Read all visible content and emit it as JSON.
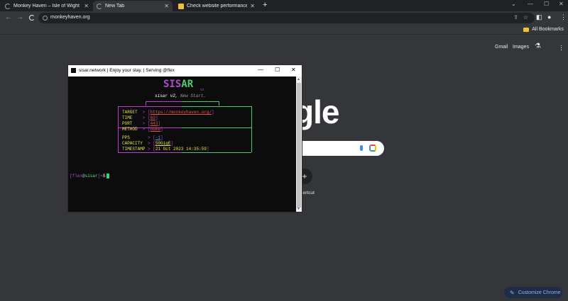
{
  "browser": {
    "tabs": [
      {
        "title": "Monkey Haven – Isle of Wight F",
        "active": false
      },
      {
        "title": "New Tab",
        "active": true
      },
      {
        "title": "Check website performance and",
        "active": false
      }
    ],
    "url": "monkeyhaven.org",
    "bookmarks_label": "All Bookmarks"
  },
  "ntp": {
    "gmail": "Gmail",
    "images": "Images",
    "logo_fragment": "gle",
    "shortcut_plus": "+",
    "shortcut_label": "hortcut",
    "customize_label": "Customize Chrome"
  },
  "terminal": {
    "title": "sisar.network | Enjoy your stay.  | Serving @flex",
    "art_left": "SIS",
    "art_right": "AR",
    "art_version": "V2",
    "subtitle_prefix": "sisar v2,",
    "subtitle_suffix": "New Start.",
    "target_key": "TARGET",
    "target_val": "https://monkeyhaven.org/",
    "time_key": "TIME",
    "time_val": "60",
    "port_key": "PORT",
    "port_val": "443",
    "method_key": "METHOD",
    "method_val": "nuke",
    "pps_key": "PPS",
    "pps_val": "-1",
    "capacity_key": "CAPACITY",
    "capacity_val": "50GigE",
    "timestamp_key": "TIMESTAMP",
    "timestamp_val": "21 Oct 2023 14:35:59",
    "prompt_user": "flex",
    "prompt_host": "sisar",
    "prompt_tail": "~$"
  },
  "colors": {
    "terminal_bg": "#0c0c0c",
    "frame_left": "#c33ad6",
    "frame_right": "#4ec96b",
    "key_yellow": "#e6e24a",
    "value_red": "#e45656"
  }
}
